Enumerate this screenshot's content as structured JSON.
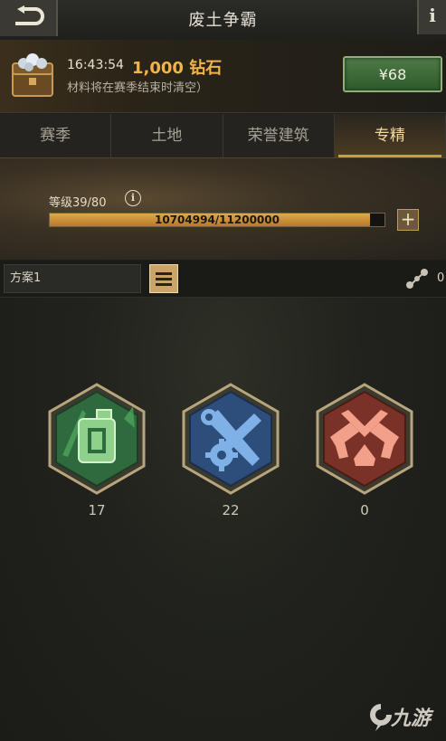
{
  "header": {
    "title": "废土争霸",
    "info_label": "i"
  },
  "promo": {
    "time": "16:43:54",
    "amount": "1,000 钻石",
    "note": "材料将在赛季结束时清空）",
    "price": "¥68",
    "pager_count": 6,
    "pager_active": 0
  },
  "tabs": [
    {
      "label": "赛季",
      "active": false
    },
    {
      "label": "土地",
      "active": false
    },
    {
      "label": "荣誉建筑",
      "active": false
    },
    {
      "label": "专精",
      "active": true
    }
  ],
  "level": {
    "label": "等级39/80",
    "xp_text": "10704994/11200000",
    "xp_current": 10704994,
    "xp_max": 11200000
  },
  "plan": {
    "name": "方案1",
    "nodes_count": "0"
  },
  "badges": [
    {
      "name": "fuel-can-badge",
      "count": "17",
      "color": "#2f6a3f",
      "accent": "#8fd08a"
    },
    {
      "name": "wrench-gear-badge",
      "count": "22",
      "color": "#2d4d7a",
      "accent": "#7fb0e6"
    },
    {
      "name": "crossed-guns-badge",
      "count": "0",
      "color": "#7a3228",
      "accent": "#f2a089"
    }
  ],
  "watermark": "九游"
}
